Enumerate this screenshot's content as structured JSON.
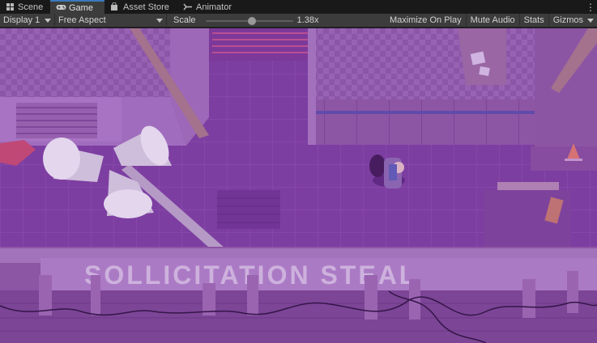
{
  "tabs": [
    {
      "label": "Scene",
      "icon": "grid-icon",
      "active": false
    },
    {
      "label": "Game",
      "icon": "gamepad-icon",
      "active": true
    },
    {
      "label": "Asset Store",
      "icon": "shopping-bag-icon",
      "active": false
    },
    {
      "label": "Animator",
      "icon": "animator-icon",
      "active": false
    }
  ],
  "tab_menu_glyph": "⋮",
  "toolbar": {
    "display": "Display 1",
    "aspect": "Free Aspect",
    "scale_label": "Scale",
    "scale_value": "1.38x",
    "maximize_label": "Maximize On Play",
    "mute_label": "Mute Audio",
    "stats_label": "Stats",
    "gizmos_label": "Gizmos"
  },
  "game_view": {
    "wall_sign_text": "SOLLICITATION STEAL",
    "tint_color": "#7a3a9a"
  },
  "colors": {
    "accent": "#3a79bb",
    "toolbar_bg": "#3c3c3c",
    "tabbar_bg": "#191919"
  }
}
